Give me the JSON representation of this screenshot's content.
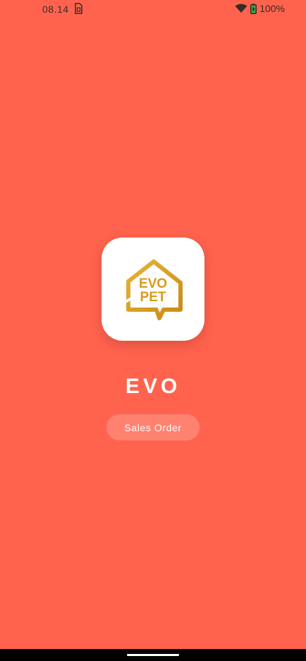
{
  "status_bar": {
    "time": "08.14",
    "battery": "100%",
    "icons": [
      "sim-card-icon",
      "wifi-icon",
      "battery-charging-icon"
    ]
  },
  "app": {
    "logo_text_top": "EVO",
    "logo_text_bottom": "PET",
    "title": "EVO",
    "subtitle": "Sales Order"
  },
  "colors": {
    "background": "#ff634e",
    "logo_gold": "#d99a1a",
    "text": "#ffffff"
  }
}
